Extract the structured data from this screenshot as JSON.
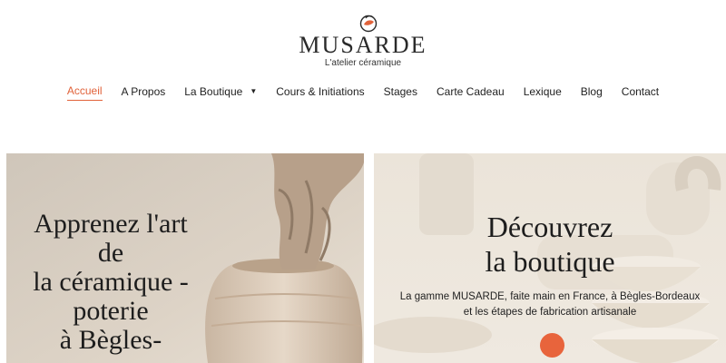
{
  "brand": {
    "name": "MUSARDE",
    "tagline": "L'atelier céramique",
    "logo_icon": "bird-logo-icon",
    "accent_color": "#e1623a"
  },
  "nav": {
    "items": [
      {
        "label": "Accueil",
        "active": true
      },
      {
        "label": "A Propos"
      },
      {
        "label": "La Boutique",
        "has_dropdown": true
      },
      {
        "label": "Cours & Initiations"
      },
      {
        "label": "Stages"
      },
      {
        "label": "Carte Cadeau"
      },
      {
        "label": "Lexique"
      },
      {
        "label": "Blog"
      },
      {
        "label": "Contact"
      }
    ]
  },
  "hero_left": {
    "lines": [
      "Apprenez l'art",
      "de",
      "la céramique -",
      "poterie",
      "à Bègles-"
    ]
  },
  "hero_right": {
    "title_line1": "Découvrez",
    "title_line2": "la boutique",
    "subtitle_line1": "La gamme MUSARDE, faite main en France, à Bègles-Bordeaux",
    "subtitle_line2": "et les étapes de fabrication artisanale",
    "button_color": "#e8643c"
  }
}
